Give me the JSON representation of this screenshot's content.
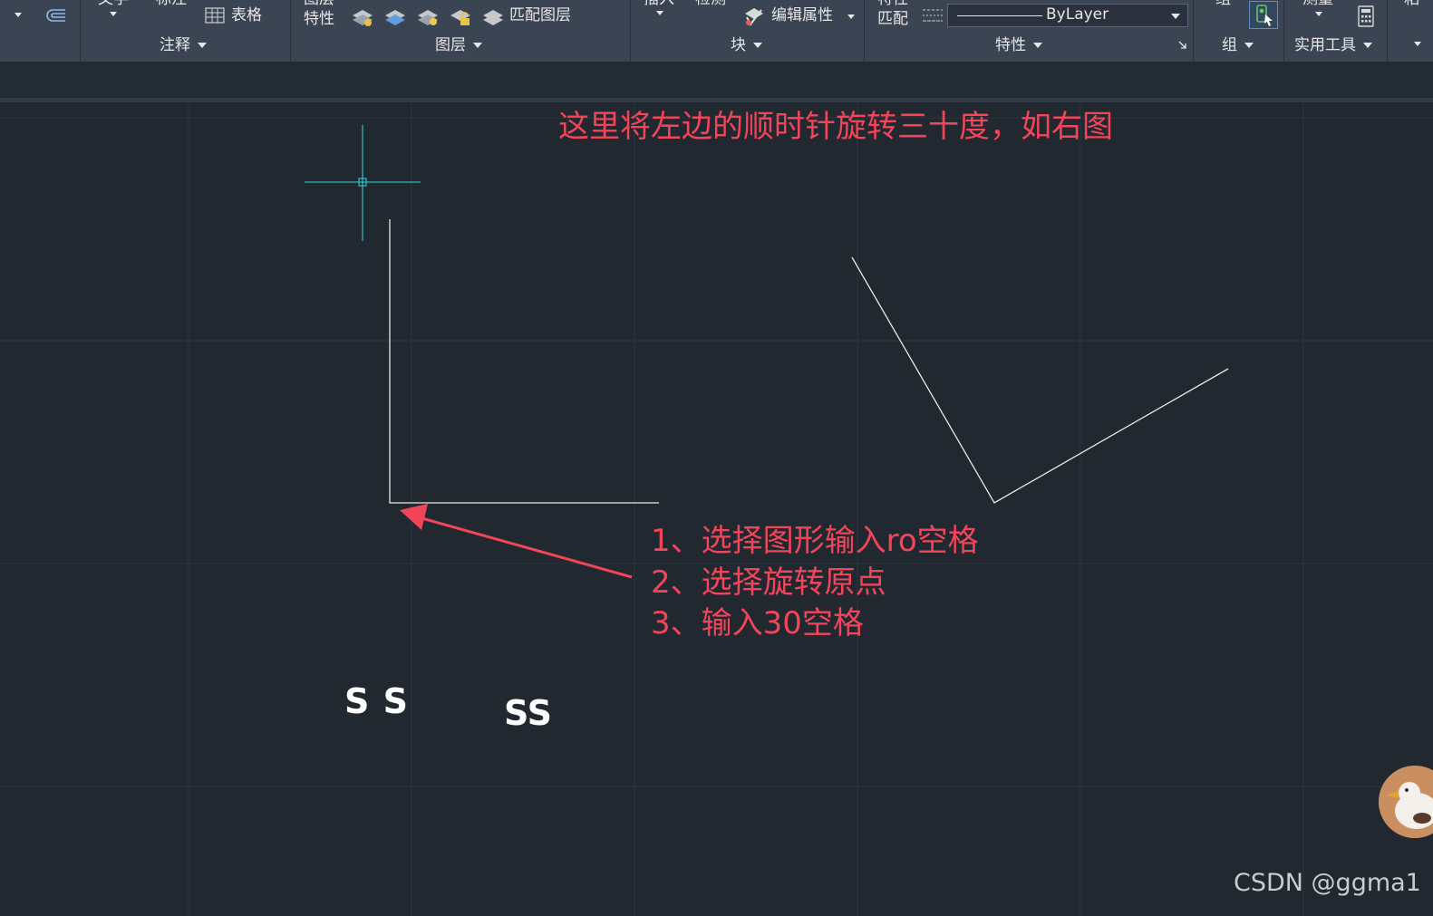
{
  "ribbon": {
    "cut_labels": {
      "text_top": "文字",
      "dim_top": "标注",
      "layer_props_1": "图层",
      "layer_props_2": "特性",
      "insert_top": "插入",
      "edit_top": "检测",
      "match_props_1": "特性",
      "match_props_2": "匹配",
      "group_top": "组",
      "measure_top": "测量",
      "right_cut": "粘"
    },
    "table_label": "表格",
    "match_layer_label": "匹配图层",
    "edit_attr_label": "编辑属性",
    "linetype_value": "ByLayer",
    "panels": {
      "annotation": "注释",
      "layers": "图层",
      "block": "块",
      "properties": "特性",
      "group": "组",
      "utilities": "实用工具"
    }
  },
  "canvas": {
    "title_annotation": "这里将左边的顺时针旋转三十度，如右图",
    "steps": [
      "1、选择图形输入ro空格",
      "2、选择旋转原点",
      "3、输入30空格"
    ],
    "letters_left": "S S",
    "letters_right": "SS"
  },
  "watermark": "CSDN @ggma1",
  "colors": {
    "background": "#212830",
    "ribbon": "#3b4453",
    "annotation_red": "#f2455a",
    "crosshair": "#2fb7bd",
    "geometry": "#e8e8e8"
  },
  "icons": [
    "dropdown-caret-icon",
    "copy-icon",
    "table-icon",
    "layer-icon",
    "block-edit-icon",
    "linetype-icon",
    "group-select-icon",
    "calculator-icon",
    "expand-icon",
    "avatar"
  ]
}
